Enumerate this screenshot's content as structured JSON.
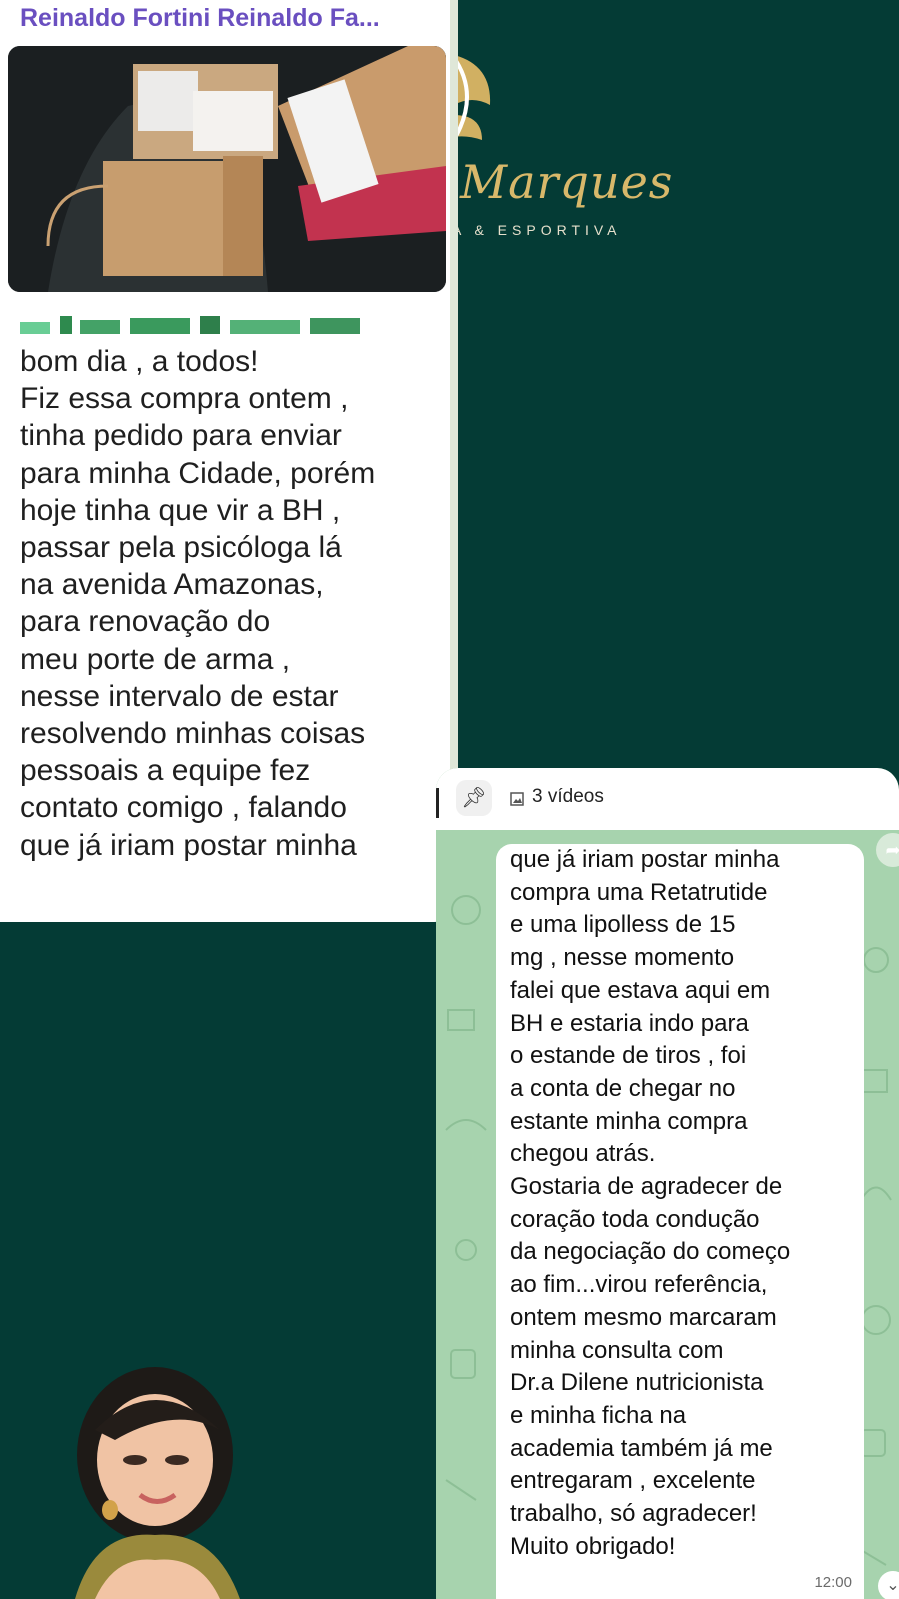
{
  "left_card": {
    "sender": "Reinaldo Fortini Reinaldo Fa...",
    "message": "bom dia , a todos!\nFiz essa compra ontem ,\ntinha pedido para enviar\npara minha Cidade,  porém\nhoje tinha que vir a BH ,\npassar pela psicóloga lá\nna avenida Amazonas,\npara renovação do\nmeu porte de arma ,\nnesse intervalo de estar\nresolvendo minhas coisas\npessoais a equipe fez\ncontato comigo , falando\nque já iriam postar minha"
  },
  "brand": {
    "name": "Marques",
    "tagline": "A & ESPORTIVA"
  },
  "right_panel": {
    "pinned_label": "3 vídeos",
    "message": "que já iriam postar minha\ncompra uma Retatrutide\ne uma lipolless de 15\nmg , nesse momento\nfalei que estava aqui em\nBH e estaria indo para\no estande de tiros , foi\na conta de chegar no\nestante minha compra\nchegou atrás.\nGostaria de agradecer de\ncoração toda condução\nda negociação do começo\nao fim...virou referência,\nontem mesmo marcaram\nminha consulta com\nDr.a Dilene nutricionista\ne minha ficha na\nacademia também já me\nentregaram , excelente\ntrabalho, só agradecer!\nMuito obrigado!",
    "time": "12:00"
  },
  "colors": {
    "background": "#043b35",
    "sender": "#6a4fc0",
    "chat_wallpaper": "#a7d3ae",
    "brand_gold": "#d8b86a"
  },
  "icons": [
    "pin-icon",
    "media-icon",
    "forward-icon",
    "chevron-down-icon"
  ]
}
